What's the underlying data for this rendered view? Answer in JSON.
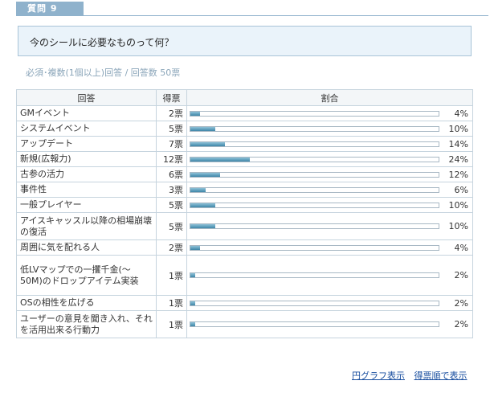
{
  "header": {
    "tab_label": "質問 9"
  },
  "question": {
    "text": "今のシールに必要なものって何？"
  },
  "meta": {
    "summary": "必須･複数(1個以上)回答 / 回答数 50票"
  },
  "table": {
    "headers": {
      "answer": "回答",
      "votes": "得票",
      "ratio": "割合"
    },
    "rows": [
      {
        "answer": "GMイベント",
        "votes": "2票",
        "percent_label": "4%",
        "percent": 4
      },
      {
        "answer": "システムイベント",
        "votes": "5票",
        "percent_label": "10%",
        "percent": 10
      },
      {
        "answer": "アップデート",
        "votes": "7票",
        "percent_label": "14%",
        "percent": 14
      },
      {
        "answer": "新規(広報力)",
        "votes": "12票",
        "percent_label": "24%",
        "percent": 24
      },
      {
        "answer": "古参の活力",
        "votes": "6票",
        "percent_label": "12%",
        "percent": 12
      },
      {
        "answer": "事件性",
        "votes": "3票",
        "percent_label": "6%",
        "percent": 6
      },
      {
        "answer": "一般プレイヤー",
        "votes": "5票",
        "percent_label": "10%",
        "percent": 10
      },
      {
        "answer": "アイスキャッスル以降の相場崩壊の復活",
        "votes": "5票",
        "percent_label": "10%",
        "percent": 10
      },
      {
        "answer": "周囲に気を配れる人",
        "votes": "2票",
        "percent_label": "4%",
        "percent": 4
      },
      {
        "answer": "低LVマップでの一攫千金(〜50M)のドロップアイテム実装",
        "votes": "1票",
        "percent_label": "2%",
        "percent": 2
      },
      {
        "answer": "OSの相性を広げる",
        "votes": "1票",
        "percent_label": "2%",
        "percent": 2
      },
      {
        "answer": "ユーザーの意見を聞き入れ、それを活用出来る行動力",
        "votes": "1票",
        "percent_label": "2%",
        "percent": 2
      }
    ]
  },
  "links": {
    "pie_chart": "円グラフ表示",
    "sort_by_votes": "得票順で表示"
  },
  "colors": {
    "tab": "#8fb2cc",
    "question_bg": "#eaf3fa",
    "bar": "#3e86a8",
    "link": "#1a4fa0"
  }
}
